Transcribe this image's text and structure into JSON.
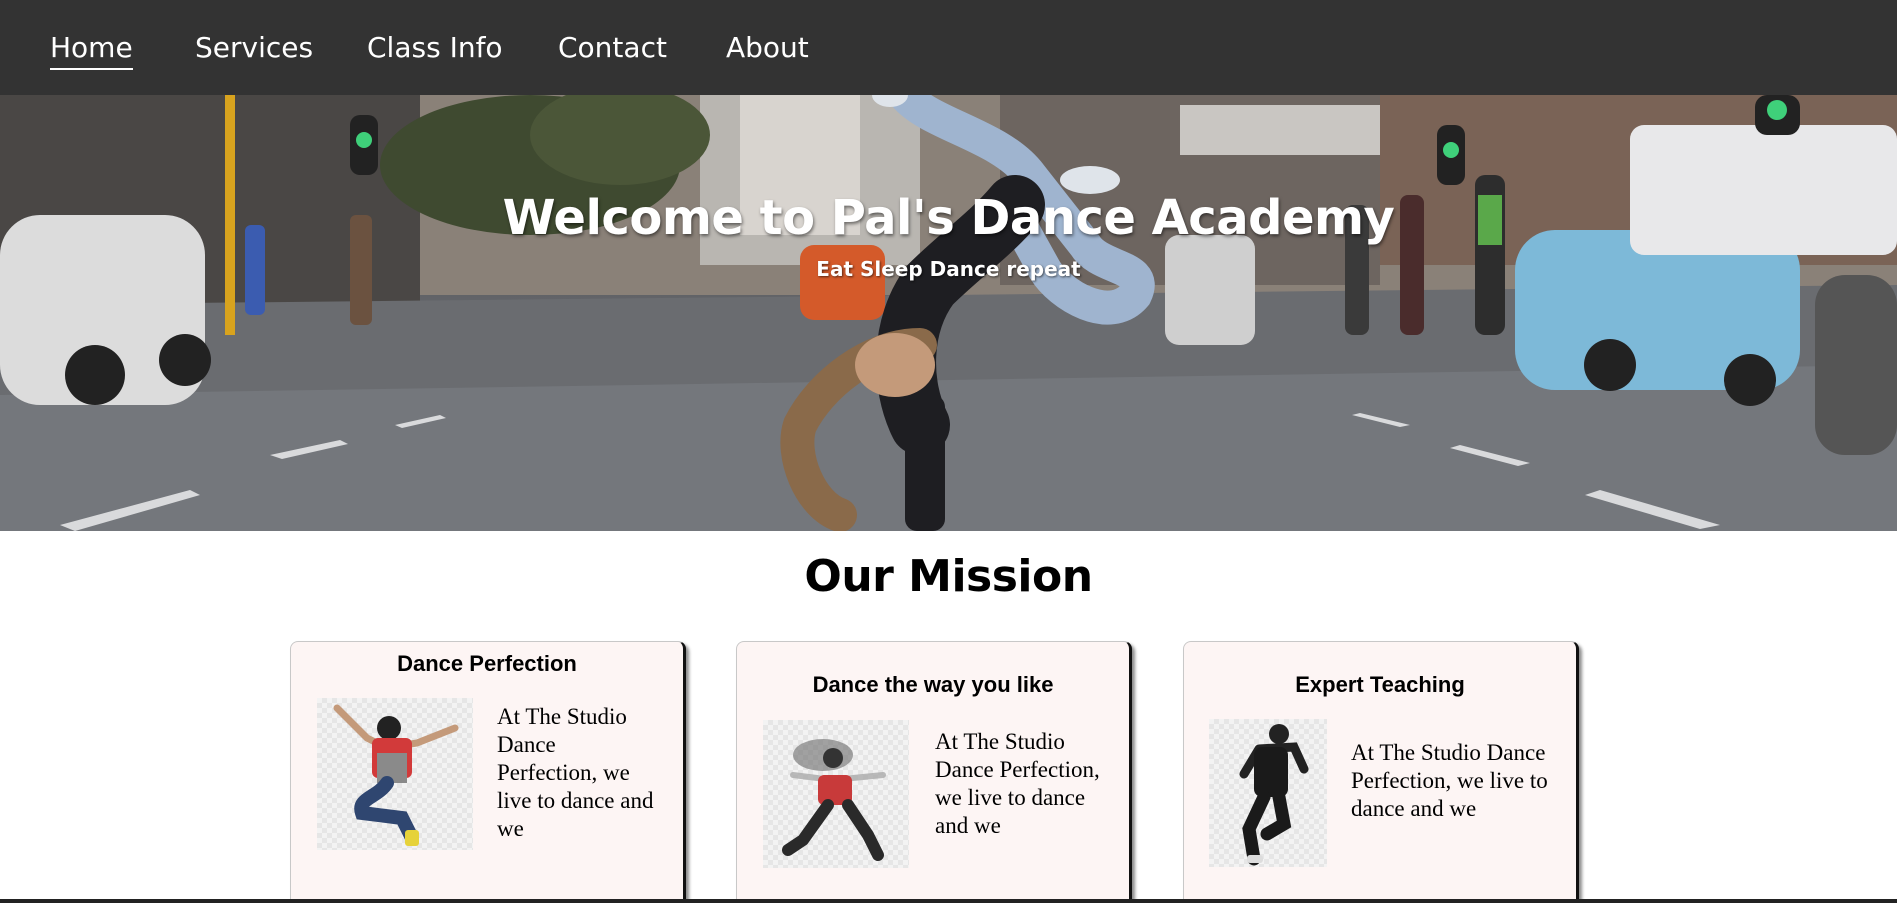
{
  "nav": {
    "items": [
      {
        "label": "Home",
        "active": true
      },
      {
        "label": "Services",
        "active": false
      },
      {
        "label": "Class Info",
        "active": false
      },
      {
        "label": "Contact",
        "active": false
      },
      {
        "label": "About",
        "active": false
      }
    ]
  },
  "hero": {
    "title": "Welcome to Pal's Dance Academy",
    "subtitle": "Eat Sleep Dance repeat"
  },
  "mission": {
    "title": "Our Mission",
    "cards": [
      {
        "heading": "Dance Perfection",
        "text": "At The Studio Dance Perfection, we live to dance and we"
      },
      {
        "heading": "Dance the way you like",
        "text": "At The Studio Dance Perfection, we live to dance and we"
      },
      {
        "heading": "Expert Teaching",
        "text": "At The Studio Dance Perfection, we live to dance and we"
      }
    ]
  },
  "colors": {
    "navbar_bg": "#333333",
    "nav_text": "#ffffff",
    "card_bg": "#fdf5f4",
    "page_bg": "#ffffff"
  },
  "icons": {
    "hero_image": "breakdancer-street-photo",
    "card_images": [
      "jumping-dancer-photo",
      "motion-blur-dancer-photo",
      "hiphop-dancer-photo"
    ]
  }
}
